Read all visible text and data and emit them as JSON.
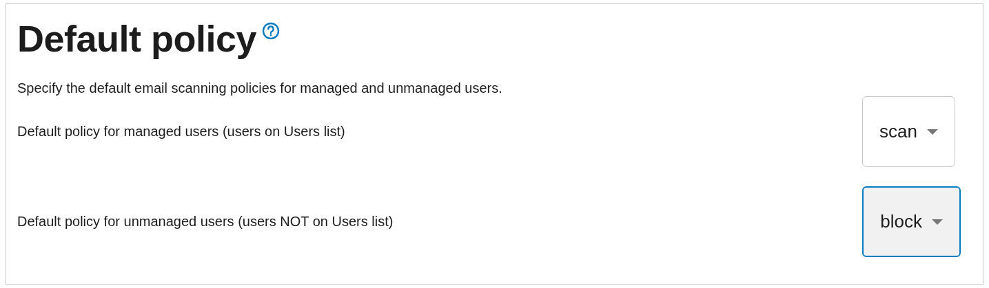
{
  "title": "Default policy",
  "description": "Specify the default email scanning policies for managed and unmanaged users.",
  "policies": [
    {
      "label": "Default policy for managed users (users on Users list)",
      "value": "scan",
      "focused": false
    },
    {
      "label": "Default policy for unmanaged users (users NOT on Users list)",
      "value": "block",
      "focused": true
    }
  ]
}
